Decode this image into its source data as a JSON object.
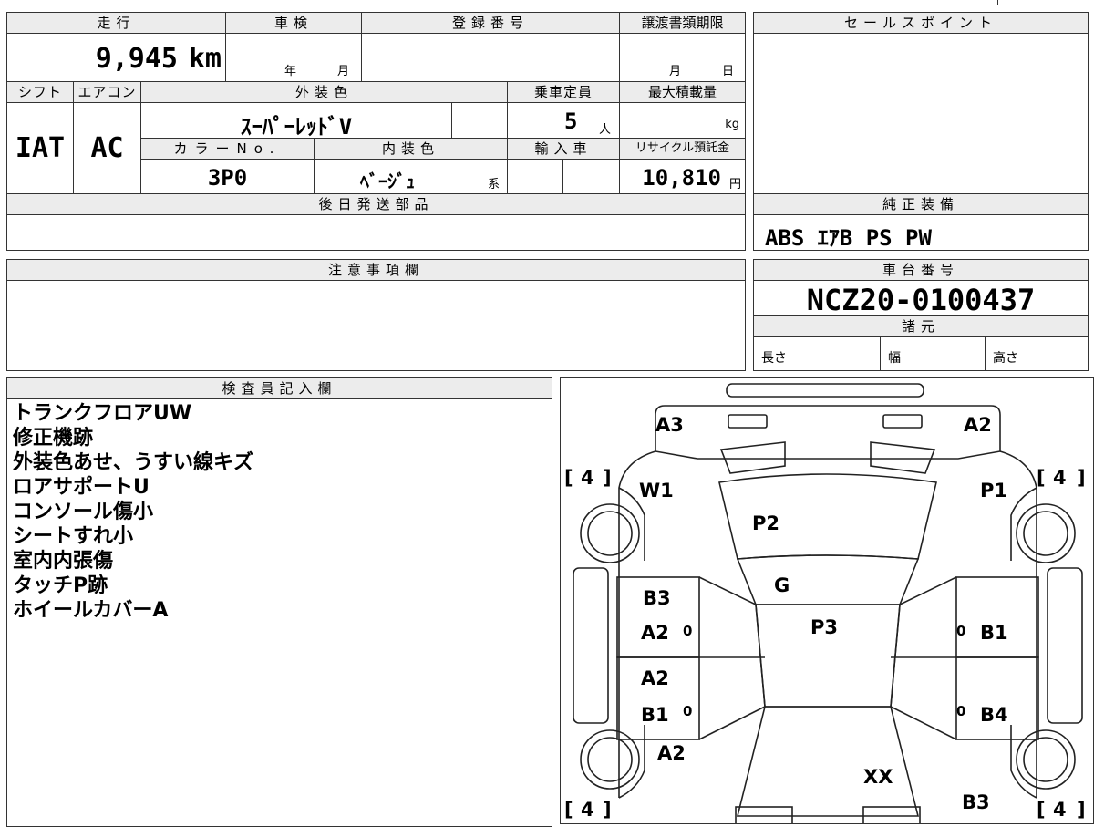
{
  "top": {
    "mileage_label": "走行",
    "mileage_value": "9,945",
    "mileage_unit": "km",
    "inspection_label": "車検",
    "inspection_year": "年",
    "inspection_month": "月",
    "registration_label": "登録番号",
    "transfer_label": "譲渡書類期限",
    "transfer_month": "月",
    "transfer_day": "日",
    "shift_label": "シフト",
    "shift_value": "IAT",
    "ac_label": "エアコン",
    "ac_value": "AC",
    "exterior_label": "外装色",
    "exterior_value": "ｽｰﾊﾟｰﾚｯﾄﾞV",
    "capacity_label": "乗車定員",
    "capacity_value": "5",
    "capacity_unit": "人",
    "maxload_label": "最大積載量",
    "maxload_unit": "kg",
    "color_no_label": "カラーNo.",
    "color_no_value": "3P0",
    "interior_label": "内装色",
    "interior_value": "ﾍﾞｰｼﾞｭ",
    "interior_suffix": "系",
    "import_label": "輸入車",
    "recycle_label": "リサイクル預託金",
    "recycle_value": "10,810",
    "recycle_unit": "円",
    "later_parts_label": "後日発送部品"
  },
  "right": {
    "sales_point_label": "セールスポイント",
    "equipment_label": "純正装備",
    "equipment_value": "ABS ｴｱB PS PW",
    "chassis_label": "車台番号",
    "chassis_value": "NCZ20-0100437",
    "specs_label": "諸元",
    "length_label": "長さ",
    "width_label": "幅",
    "height_label": "高さ"
  },
  "notes_label": "注意事項欄",
  "inspector": {
    "label": "検査員記入欄",
    "lines": [
      "トランクフロアUW",
      "修正機跡",
      "外装色あせ、うすい線キズ",
      "ロアサポートU",
      "コンソール傷小",
      "シートすれ小",
      "室内内張傷",
      "タッチP跡",
      "ホイールカバーA"
    ]
  },
  "diagram": {
    "marks": {
      "a3_top": "A3",
      "a2_top": "A2",
      "w1": "W1",
      "p1": "P1",
      "p2": "P2",
      "g": "G",
      "p3": "P3",
      "b3_left": "B3",
      "a2_left_front": "A2",
      "b1_right": "B1",
      "a2_left_rear": "A2",
      "b1_left": "B1",
      "b4_right": "B4",
      "a2_left_bottom": "A2",
      "xx": "XX",
      "b3_bottom": "B3"
    },
    "zero": "0",
    "tire": "4",
    "bracket_l": "[",
    "bracket_r": "]"
  }
}
